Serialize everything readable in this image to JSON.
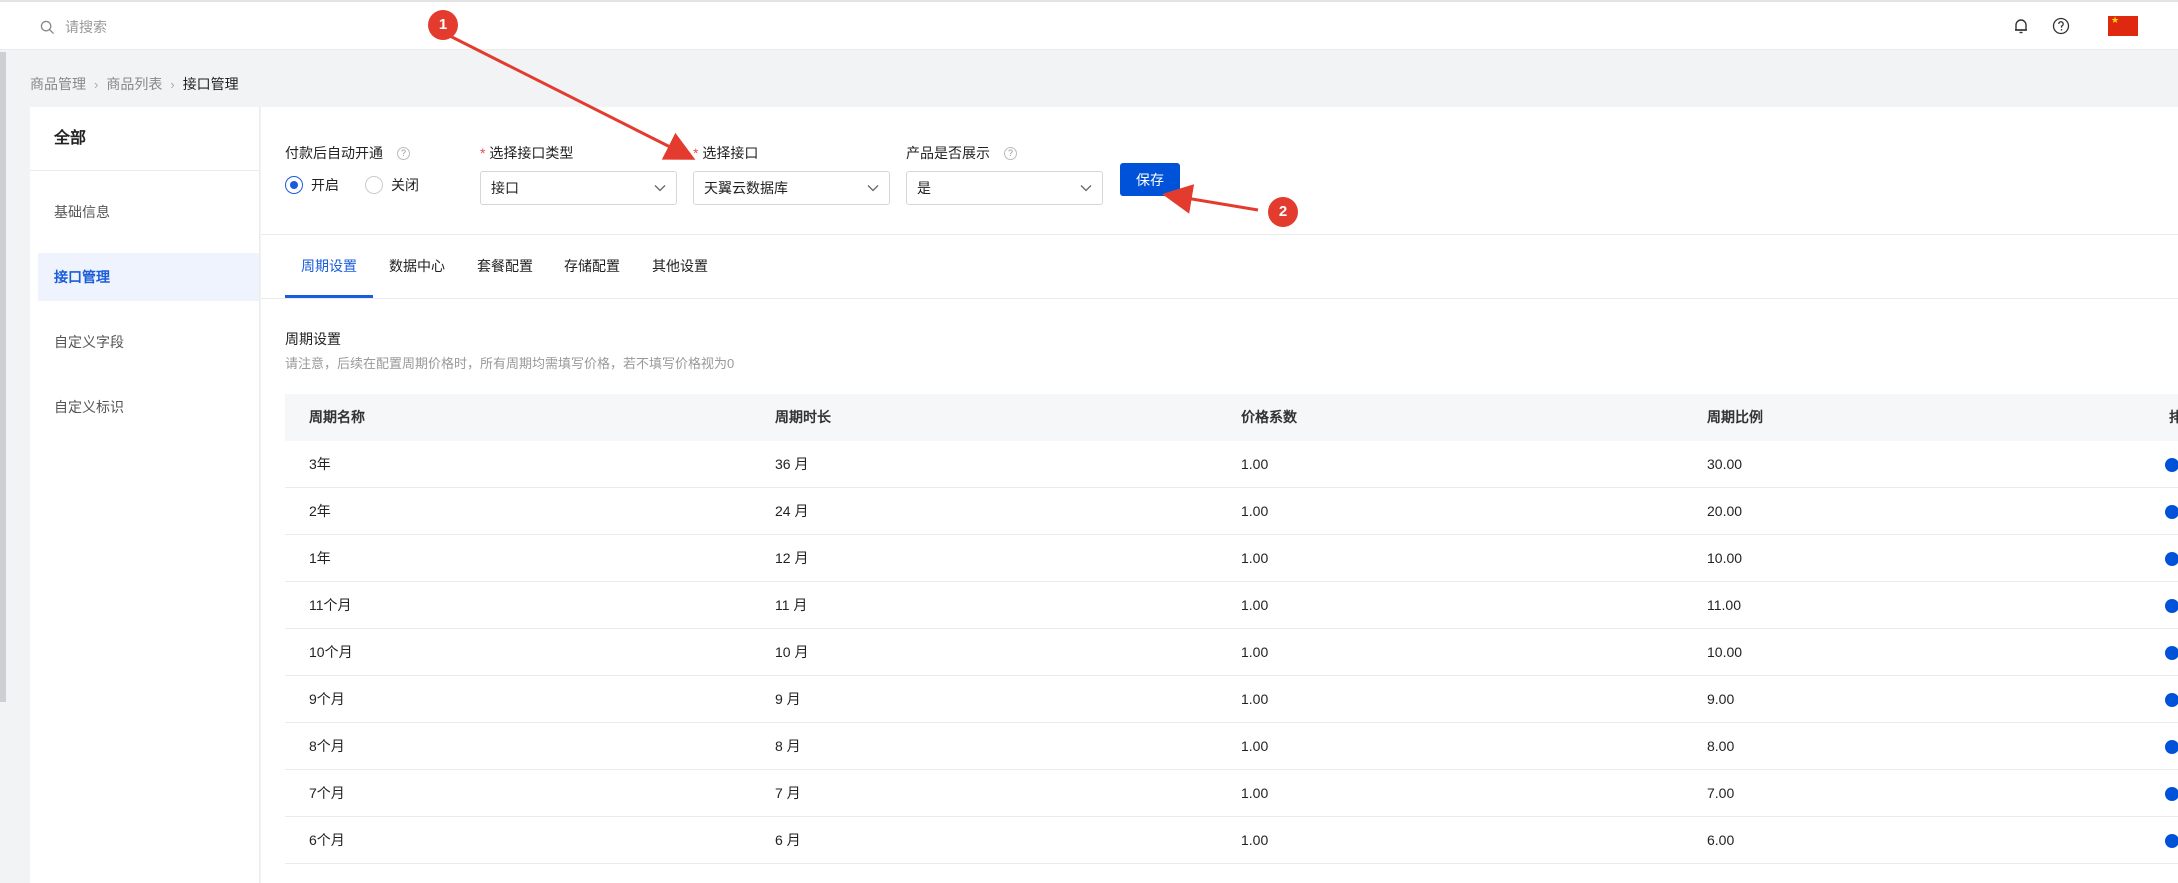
{
  "topbar": {
    "search_placeholder": "请搜索",
    "icons": [
      "search-icon",
      "bell-icon",
      "help-icon",
      "china-flag-icon"
    ]
  },
  "breadcrumb": [
    "商品管理",
    "商品列表",
    "接口管理"
  ],
  "sidebar": {
    "title": "全部",
    "items": [
      {
        "label": "基础信息",
        "active": false
      },
      {
        "label": "接口管理",
        "active": true
      },
      {
        "label": "自定义字段",
        "active": false
      },
      {
        "label": "自定义标识",
        "active": false
      }
    ]
  },
  "form": {
    "auto_open": {
      "label": "付款后自动开通",
      "options": [
        "开启",
        "关闭"
      ],
      "selected": "开启"
    },
    "interface_type": {
      "label": "选择接口类型",
      "value": "接口"
    },
    "interface": {
      "label": "选择接口",
      "value": "天翼云数据库"
    },
    "show_product": {
      "label": "产品是否展示",
      "value": "是"
    },
    "save_label": "保存"
  },
  "tabs": [
    "周期设置",
    "数据中心",
    "套餐配置",
    "存储配置",
    "其他设置"
  ],
  "period": {
    "title": "周期设置",
    "note": "请注意，后续在配置周期价格时，所有周期均需填写价格，若不填写价格视为0",
    "columns": [
      "周期名称",
      "周期时长",
      "价格系数",
      "周期比例"
    ],
    "rows": [
      [
        "3年",
        "36 月",
        "1.00",
        "30.00"
      ],
      [
        "2年",
        "24 月",
        "1.00",
        "20.00"
      ],
      [
        "1年",
        "12 月",
        "1.00",
        "10.00"
      ],
      [
        "11个月",
        "11 月",
        "1.00",
        "11.00"
      ],
      [
        "10个月",
        "10 月",
        "1.00",
        "10.00"
      ],
      [
        "9个月",
        "9 月",
        "1.00",
        "9.00"
      ],
      [
        "8个月",
        "8 月",
        "1.00",
        "8.00"
      ],
      [
        "7个月",
        "7 月",
        "1.00",
        "7.00"
      ],
      [
        "6个月",
        "6 月",
        "1.00",
        "6.00"
      ]
    ]
  },
  "annotations": [
    "1",
    "2"
  ],
  "colors": {
    "primary": "#0052d9",
    "annotation": "#e43b2f"
  }
}
